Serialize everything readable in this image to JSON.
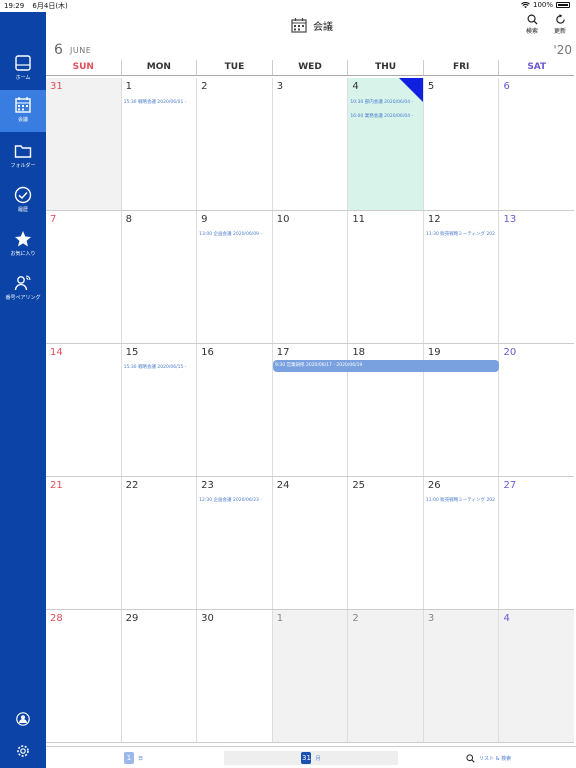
{
  "status": {
    "time": "19:29",
    "date": "6月4日(木)",
    "battery": "100%"
  },
  "header": {
    "title": "会議",
    "search_label": "検索",
    "refresh_label": "更新"
  },
  "sidebar": {
    "items": [
      {
        "label": "ホーム",
        "icon": "home-icon"
      },
      {
        "label": "会議",
        "icon": "calendar-icon"
      },
      {
        "label": "フォルダー",
        "icon": "folder-icon"
      },
      {
        "label": "履歴",
        "icon": "check-circle-icon"
      },
      {
        "label": "お気に入り",
        "icon": "star-icon"
      },
      {
        "label": "番号ペアリング",
        "icon": "user-signal-icon"
      }
    ],
    "bottom_icons": [
      "account-icon",
      "settings-icon"
    ]
  },
  "calendar": {
    "month_num": "6",
    "month_name": "JUNE",
    "year": "'20",
    "weekdays": [
      "SUN",
      "MON",
      "TUE",
      "WED",
      "THU",
      "FRI",
      "SAT"
    ],
    "weeks": [
      [
        {
          "day": "31",
          "dim": true,
          "events": []
        },
        {
          "day": "1",
          "events": [
            "15:30 戦略会議 2020/06/01 -"
          ]
        },
        {
          "day": "2",
          "events": []
        },
        {
          "day": "3",
          "events": []
        },
        {
          "day": "4",
          "today": true,
          "events": [
            "10:30 部内会議 2020/06/04 -",
            "16:00 業務会議 2020/06/04 -"
          ]
        },
        {
          "day": "5",
          "events": []
        },
        {
          "day": "6",
          "events": []
        }
      ],
      [
        {
          "day": "7",
          "events": []
        },
        {
          "day": "8",
          "events": []
        },
        {
          "day": "9",
          "events": [
            "13:00 企画会議 2020/06/09 -"
          ]
        },
        {
          "day": "10",
          "events": []
        },
        {
          "day": "11",
          "events": []
        },
        {
          "day": "12",
          "events": [
            "11:30 販売戦略ミーティング 202"
          ]
        },
        {
          "day": "13",
          "events": []
        }
      ],
      [
        {
          "day": "14",
          "events": []
        },
        {
          "day": "15",
          "events": [
            "15:30 戦略会議 2020/06/15 -"
          ]
        },
        {
          "day": "16",
          "events": []
        },
        {
          "day": "17",
          "events": []
        },
        {
          "day": "18",
          "events": []
        },
        {
          "day": "19",
          "events": []
        },
        {
          "day": "20",
          "events": []
        }
      ],
      [
        {
          "day": "21",
          "events": []
        },
        {
          "day": "22",
          "events": []
        },
        {
          "day": "23",
          "events": [
            "12:30 企画会議 2020/06/23 -"
          ]
        },
        {
          "day": "24",
          "events": []
        },
        {
          "day": "25",
          "events": []
        },
        {
          "day": "26",
          "events": [
            "11:00 販売戦略ミーティング 202"
          ]
        },
        {
          "day": "27",
          "events": []
        }
      ],
      [
        {
          "day": "28",
          "events": []
        },
        {
          "day": "29",
          "events": []
        },
        {
          "day": "30",
          "events": []
        },
        {
          "day": "1",
          "dim": true,
          "events": []
        },
        {
          "day": "2",
          "dim": true,
          "events": []
        },
        {
          "day": "3",
          "dim": true,
          "events": []
        },
        {
          "day": "4",
          "dim": true,
          "events": []
        }
      ]
    ],
    "span_event": "9:30 営業研修 2020/06/17 - 2020/06/19"
  },
  "bottom_bar": {
    "day_badge": "1",
    "day_label": "日",
    "month_badge": "31",
    "month_label": "月",
    "list_label": "リスト & 検索"
  },
  "colors": {
    "sidebar": "#0b44a6",
    "sidebar_active": "#3a7de0",
    "today": "#d8f3ea",
    "event_text": "#4a7bd0",
    "span_bar": "#7aa1df",
    "sunday": "#e0505a",
    "saturday": "#6a5ad0"
  }
}
